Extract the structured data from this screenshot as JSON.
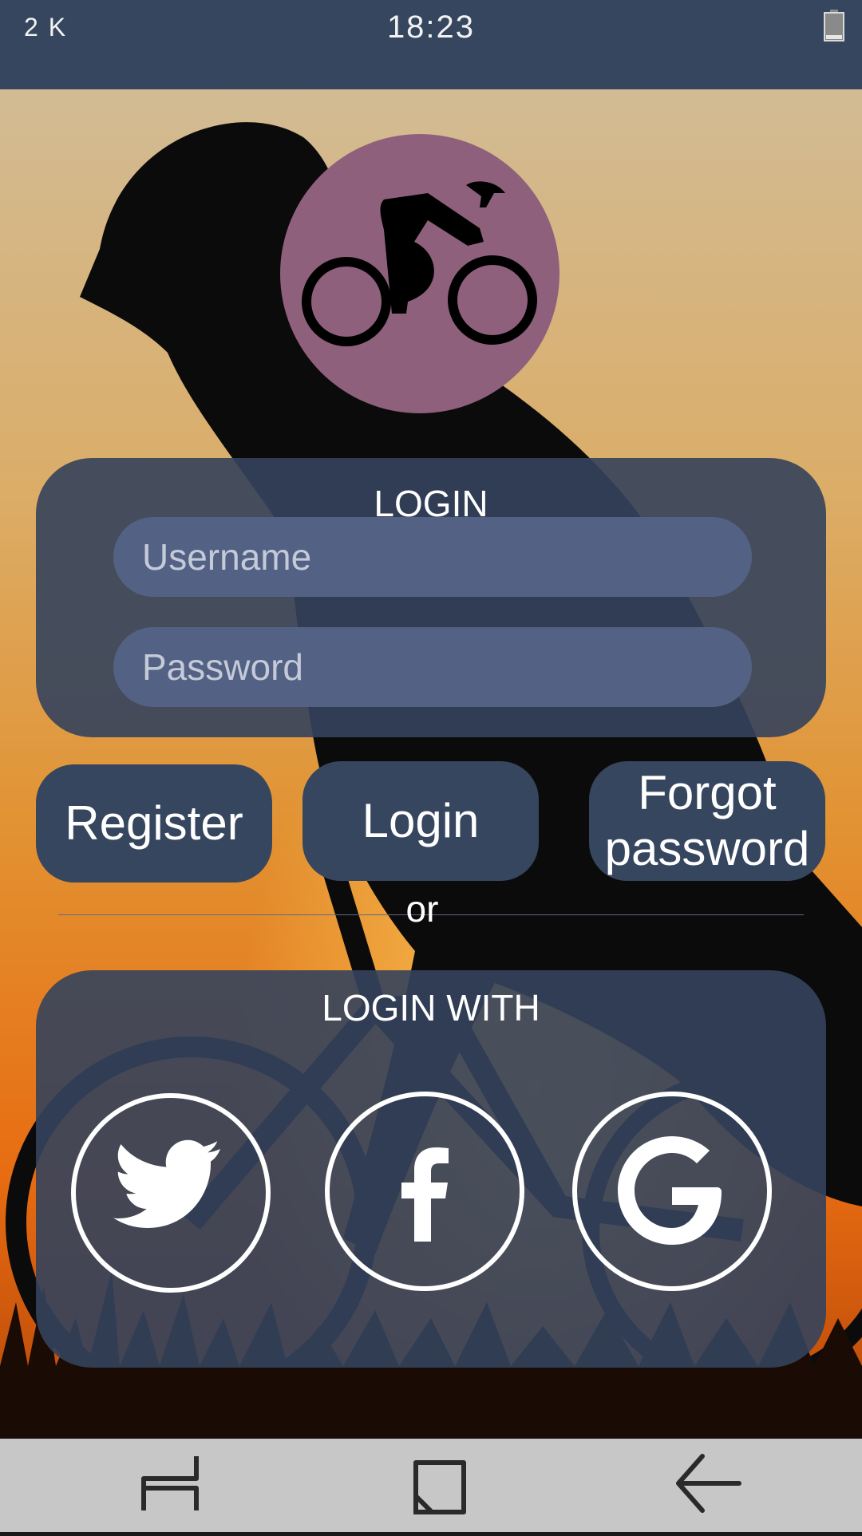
{
  "status": {
    "signal": "2 K",
    "time": "18:23",
    "battery_icon": "battery-icon"
  },
  "colors": {
    "status_bar": "#36465e",
    "panel": "#34425c",
    "input": "#536284",
    "logo_circle": "#8e607c",
    "navbar": "#c7c7c7"
  },
  "logo": {
    "icon": "cyclist-icon"
  },
  "login_panel": {
    "title": "LOGIN",
    "username_placeholder": "Username",
    "password_placeholder": "Password"
  },
  "buttons": {
    "register": "Register",
    "login": "Login",
    "forgot_password": "Forgot password"
  },
  "divider_label": "or",
  "social_panel": {
    "title": "LOGIN WITH",
    "providers": [
      {
        "icon": "twitter-icon"
      },
      {
        "icon": "facebook-icon"
      },
      {
        "icon": "google-icon"
      }
    ]
  },
  "navbar": {
    "items": [
      "recent-apps-icon",
      "home-icon",
      "back-icon"
    ]
  }
}
